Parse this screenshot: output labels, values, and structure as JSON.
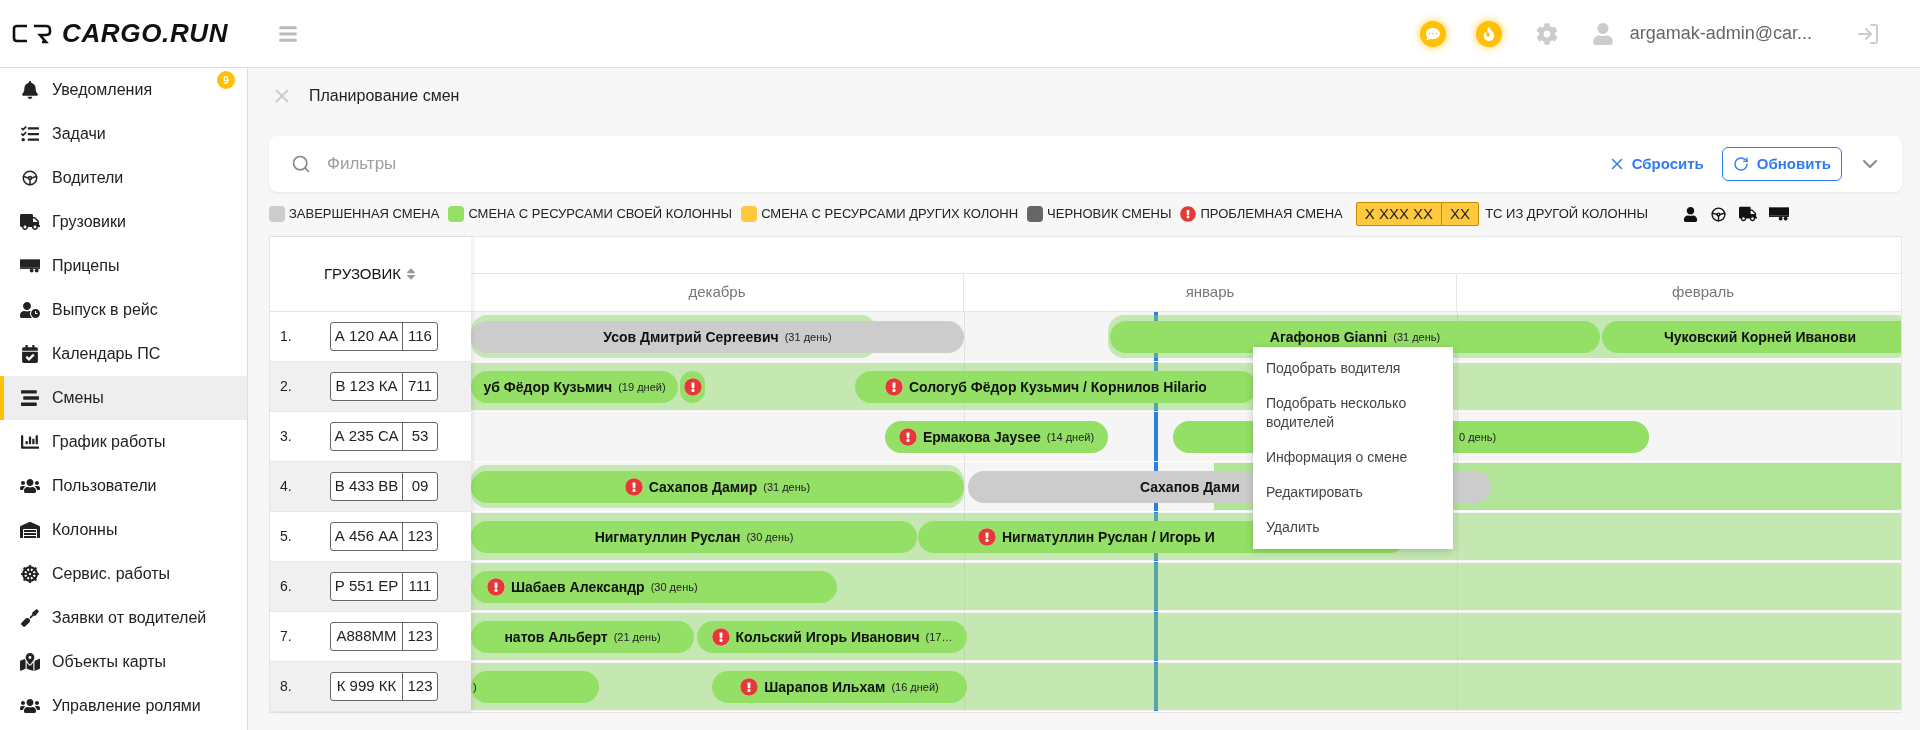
{
  "logo": {
    "text": "CARGO.RUN"
  },
  "header": {
    "user": "argamak-admin@car..."
  },
  "sidebar": {
    "items": [
      {
        "label": "Уведомления",
        "selected": false,
        "badge": "9"
      },
      {
        "label": "Задачи",
        "selected": false
      },
      {
        "label": "Водители",
        "selected": false
      },
      {
        "label": "Грузовики",
        "selected": false
      },
      {
        "label": "Прицепы",
        "selected": false
      },
      {
        "label": "Выпуск в рейс",
        "selected": false
      },
      {
        "label": "Календарь ПС",
        "selected": false
      },
      {
        "label": "Смены",
        "selected": true
      },
      {
        "label": "График работы",
        "selected": false
      },
      {
        "label": "Пользователи",
        "selected": false
      },
      {
        "label": "Колонны",
        "selected": false
      },
      {
        "label": "Сервис. работы",
        "selected": false
      },
      {
        "label": "Заявки от водителей",
        "selected": false
      },
      {
        "label": "Объекты карты",
        "selected": false
      },
      {
        "label": "Управление ролями",
        "selected": false
      }
    ]
  },
  "page": {
    "title": "Планирование смен"
  },
  "filters": {
    "placeholder": "Фильтры",
    "reset": "Сбросить",
    "refresh": "Обновить"
  },
  "legend": [
    {
      "kind": "swatch",
      "color": "#cccccc",
      "label": "ЗАВЕРШЕННАЯ СМЕНА"
    },
    {
      "kind": "swatch",
      "color": "#94df65",
      "label": "СМЕНА С РЕСУРСАМИ СВОЕЙ КОЛОННЫ"
    },
    {
      "kind": "swatch",
      "color": "#ffc83d",
      "label": "СМЕНА С РЕСУРСАМИ ДРУГИХ КОЛОНН"
    },
    {
      "kind": "swatch",
      "color": "#666666",
      "label": "ЧЕРНОВИК СМЕНЫ"
    },
    {
      "kind": "problem",
      "label": "ПРОБЛЕМНАЯ СМЕНА"
    },
    {
      "kind": "plate",
      "number": "X XXX XX",
      "region": "XX",
      "label": "ТС ИЗ ДРУГОЙ КОЛОННЫ"
    }
  ],
  "table": {
    "column": "ГРУЗОВИК",
    "months": [
      "декабрь",
      "январь",
      "февраль"
    ],
    "rows": [
      {
        "index": "1.",
        "plate": "А 120 АА",
        "region": "116",
        "shifts": [
          {
            "kind": "completed",
            "problem": false,
            "driver": "Усов Дмитрий Сергеевич",
            "duration": "(31 день)"
          },
          {
            "kind": "own",
            "problem": false,
            "driver": "Агафонов Gianni",
            "duration": "(31 день)"
          },
          {
            "kind": "own",
            "problem": false,
            "driver": "Чуковский Корней Иванови"
          }
        ]
      },
      {
        "index": "2.",
        "plate": "В 123 КА",
        "region": "711",
        "shifts": [
          {
            "kind": "own",
            "problem": false,
            "driver": "уб Фёдор Кузьмич",
            "duration": "(19 дней)"
          },
          {
            "kind": "own",
            "problem": true
          },
          {
            "kind": "own",
            "problem": true,
            "driver": "Сологуб Фёдор Кузьмич / Корнилов Hilario"
          }
        ]
      },
      {
        "index": "3.",
        "plate": "А 235 СА",
        "region": "53",
        "shifts": [
          {
            "kind": "own",
            "problem": true,
            "driver": "Ермакова Jaysee",
            "duration": "(14 дней)"
          },
          {
            "kind": "own",
            "problem": false,
            "duration": "0 день)"
          }
        ]
      },
      {
        "index": "4.",
        "plate": "В 433 ВВ",
        "region": "09",
        "shifts": [
          {
            "kind": "own",
            "problem": true,
            "driver": "Сахапов Дамир",
            "duration": "(31 день)"
          },
          {
            "kind": "completed",
            "problem": false,
            "driver": "Сахапов Дами"
          }
        ]
      },
      {
        "index": "5.",
        "plate": "А 456 АА",
        "region": "123",
        "shifts": [
          {
            "kind": "own",
            "problem": false,
            "driver": "Нигматуллин Руслан",
            "duration": "(30 день)"
          },
          {
            "kind": "own",
            "problem": true,
            "driver": "Нигматуллин Руслан / Игорь И"
          }
        ]
      },
      {
        "index": "6.",
        "plate": "Р 551 ЕР",
        "region": "111",
        "shifts": [
          {
            "kind": "own",
            "problem": true,
            "driver": "Шабаев Александр",
            "duration": "(30 день)"
          }
        ]
      },
      {
        "index": "7.",
        "plate": "А888ММ",
        "region": "123",
        "shifts": [
          {
            "kind": "own",
            "problem": false,
            "driver": "натов Альберт",
            "duration": "(21 день)"
          },
          {
            "kind": "own",
            "problem": true,
            "driver": "Кольский Игорь Иванович",
            "duration": "(17…"
          }
        ]
      },
      {
        "index": "8.",
        "plate": "К 999 КК",
        "region": "123",
        "shifts": [
          {
            "kind": "own",
            "problem": false,
            "duration": ")"
          },
          {
            "kind": "own",
            "problem": true,
            "driver": "Шарапов Ильхам",
            "duration": "(16 дней)"
          }
        ]
      }
    ]
  },
  "context_menu": {
    "items": [
      "Подобрать водителя",
      "Подобрать несколько водителей",
      "Информация о смене",
      "Редактировать",
      "Удалить"
    ]
  }
}
